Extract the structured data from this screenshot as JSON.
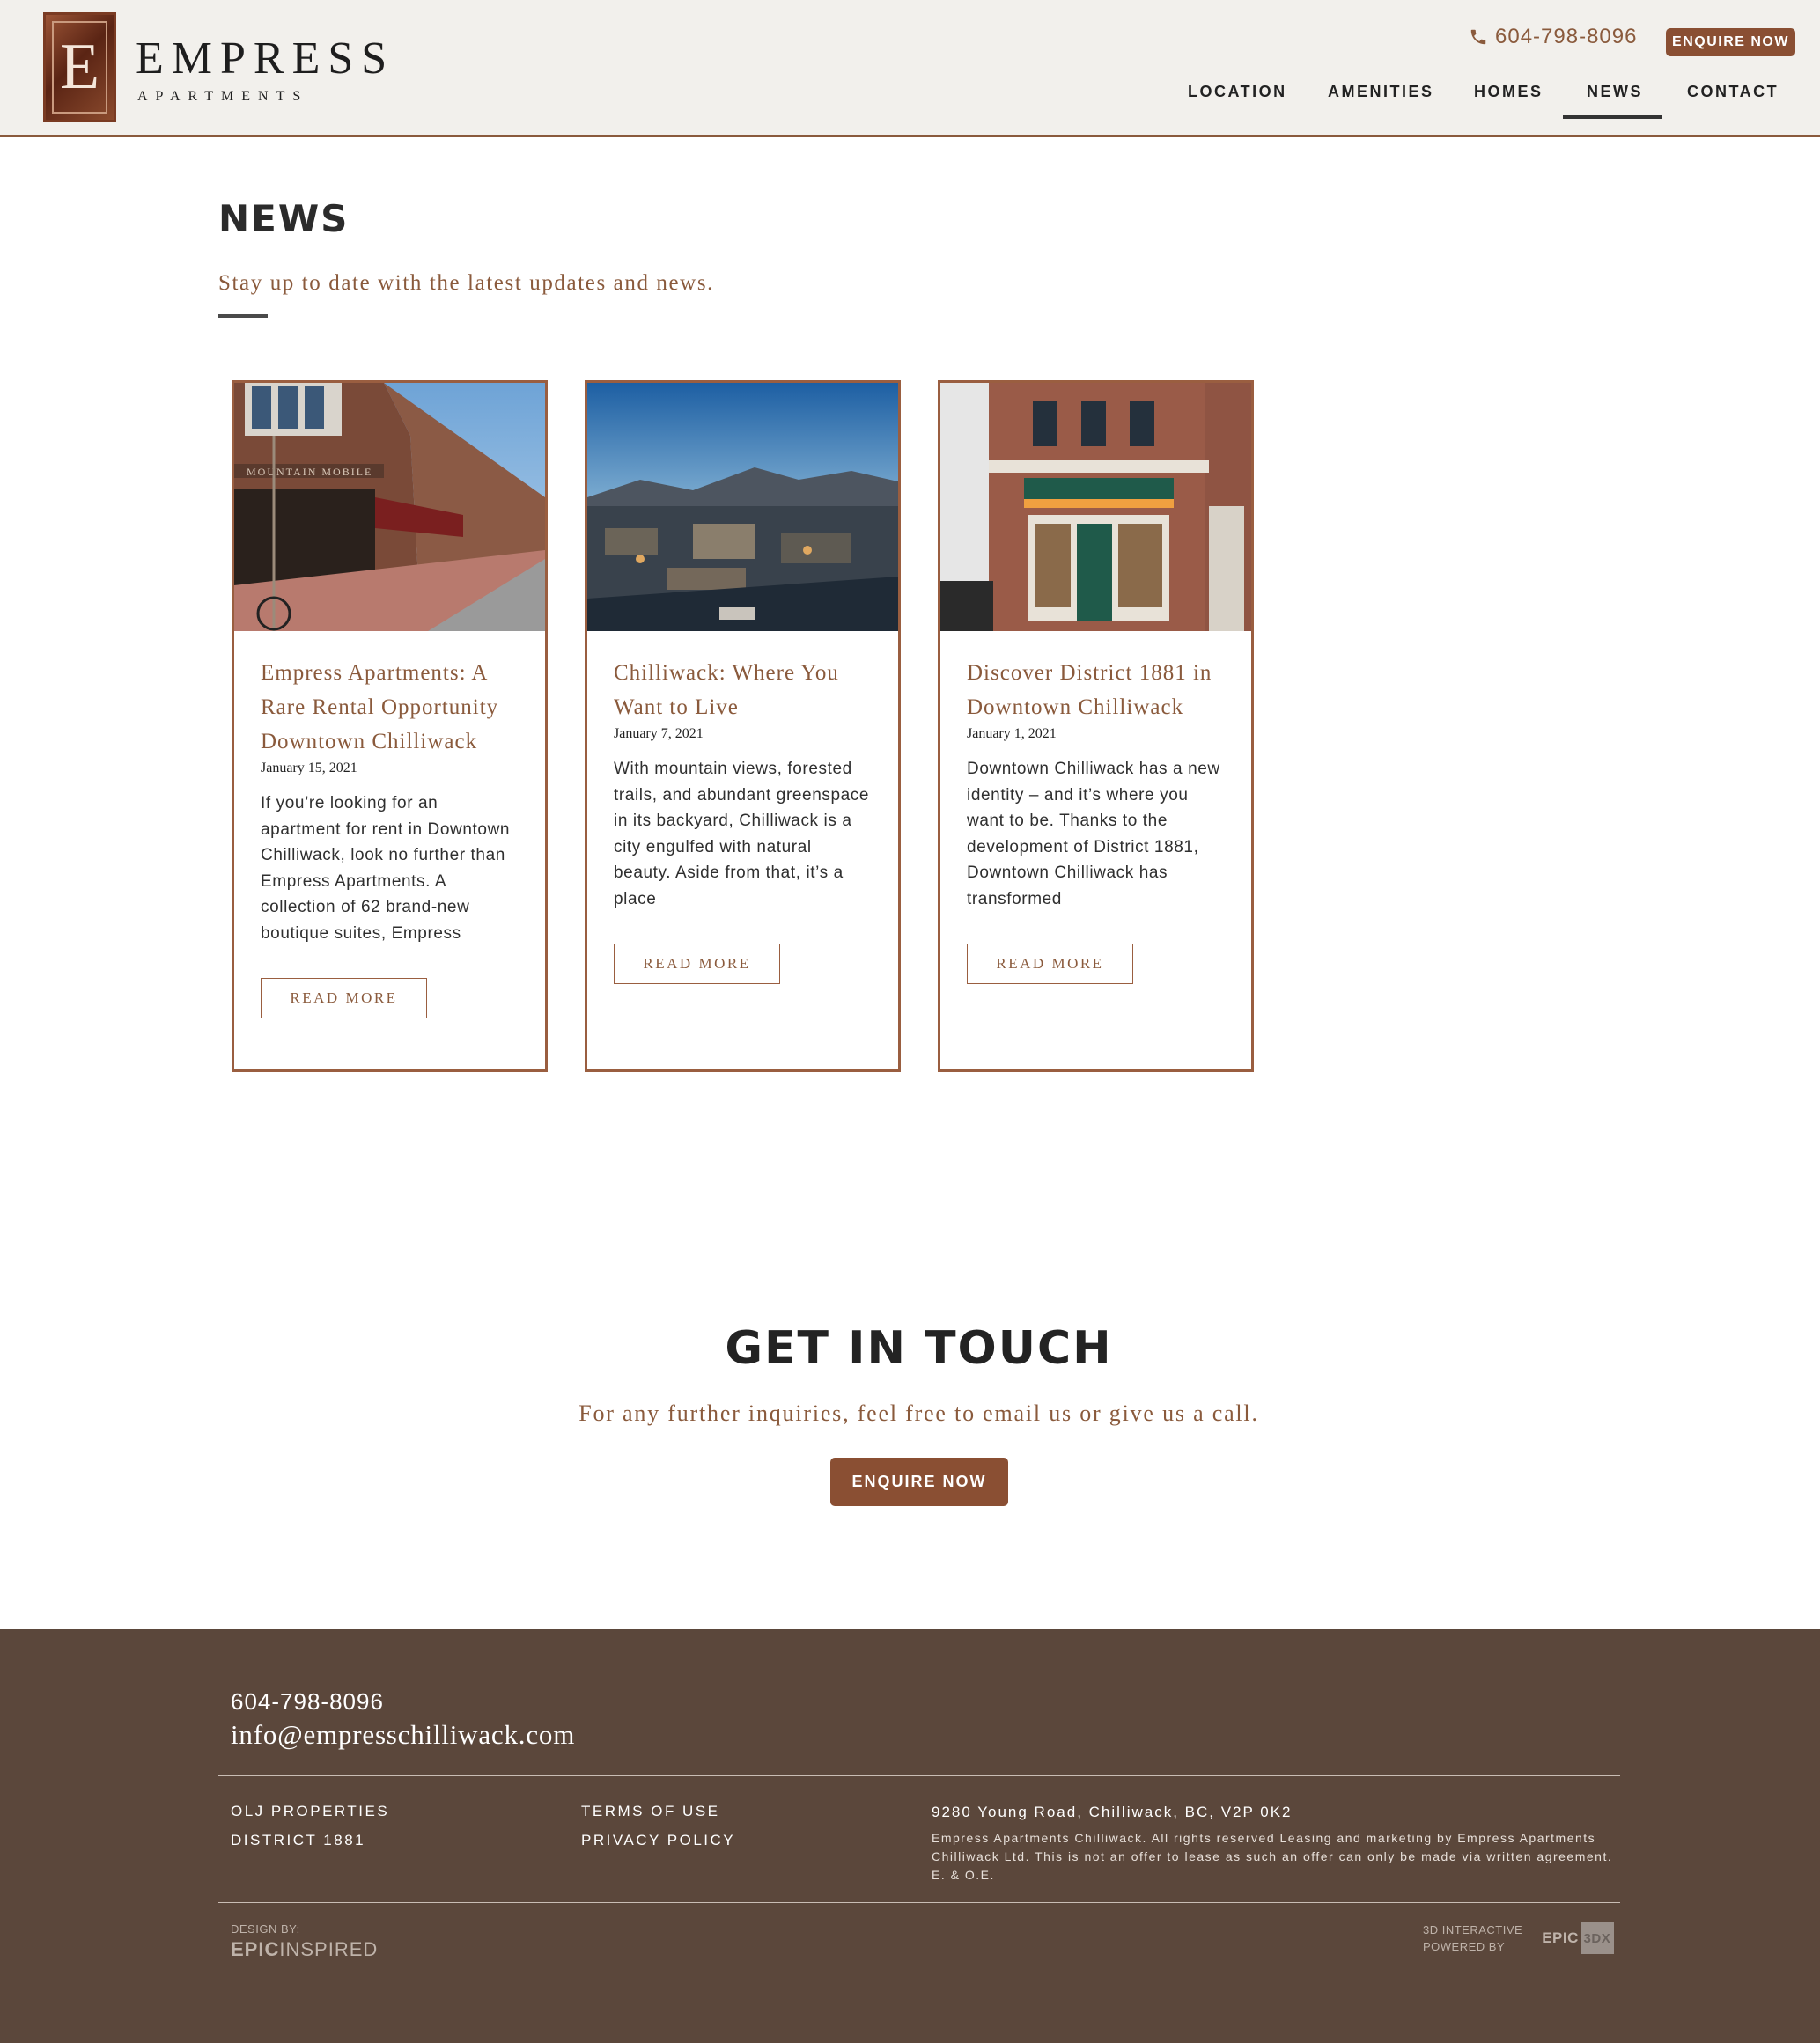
{
  "brand": {
    "name": "EMPRESS",
    "tagline": "APARTMENTS",
    "monogram": "E"
  },
  "header": {
    "phone": "604-798-8096",
    "enquire_label": "ENQUIRE NOW",
    "nav": [
      "LOCATION",
      "AMENITIES",
      "HOMES",
      "NEWS",
      "CONTACT"
    ],
    "active_nav": "NEWS"
  },
  "news": {
    "title": "NEWS",
    "subtitle": "Stay up to date with the latest updates and news.",
    "articles": [
      {
        "title": "Empress Apartments: A Rare Rental Opportunity Downtown Chilliwack",
        "date": "January 15, 2021",
        "excerpt": "If you’re looking for an apartment for rent in Downtown Chilliwack, look no further than Empress Apartments. A collection of 62 brand-new boutique suites, Empress",
        "button": "READ MORE",
        "image_sign": "MOUNTAIN MOBILE"
      },
      {
        "title": "Chilliwack: Where You Want to Live",
        "date": "January 7, 2021",
        "excerpt": "With mountain views, forested trails, and abundant greenspace in its backyard, Chilliwack is a city engulfed with natural beauty. Aside from that, it’s a place",
        "button": "READ MORE"
      },
      {
        "title": "Discover District 1881 in Downtown Chilliwack",
        "date": "January 1, 2021",
        "excerpt": "Downtown Chilliwack has a new identity – and it’s where you want to be. Thanks to the development of District 1881, Downtown Chilliwack has transformed",
        "button": "READ MORE"
      }
    ]
  },
  "contact_cta": {
    "title": "GET IN TOUCH",
    "subtitle": "For any further inquiries, feel free to email us or give us a call.",
    "button": "ENQUIRE NOW"
  },
  "footer": {
    "phone": "604-798-8096",
    "email": "info@empresschilliwack.com",
    "links_left": [
      "OLJ PROPERTIES",
      "DISTRICT 1881"
    ],
    "links_mid": [
      "TERMS OF USE",
      "PRIVACY POLICY"
    ],
    "address": "9280 Young Road, Chilliwack, BC, V2P 0K2",
    "legal": "Empress Apartments Chilliwack. All rights reserved Leasing and marketing by Empress Apartments Chilliwack Ltd. This is not an offer to lease as such an offer can only be made via written agreement. E. & O.E.",
    "design_by_label": "DESIGN BY:",
    "design_by_bold": "EPIC",
    "design_by_light": "INSPIRED",
    "powered_line1": "3D INTERACTIVE",
    "powered_line2": "POWERED BY",
    "powered_logo_text": "EPIC",
    "powered_logo_box": "3DX"
  },
  "colors": {
    "accent": "#8a4f33",
    "text_accent": "#8a5a3c",
    "header_bg": "#f2f0ec",
    "footer_bg": "#5b473b"
  },
  "icons": {
    "phone": "phone-icon"
  }
}
